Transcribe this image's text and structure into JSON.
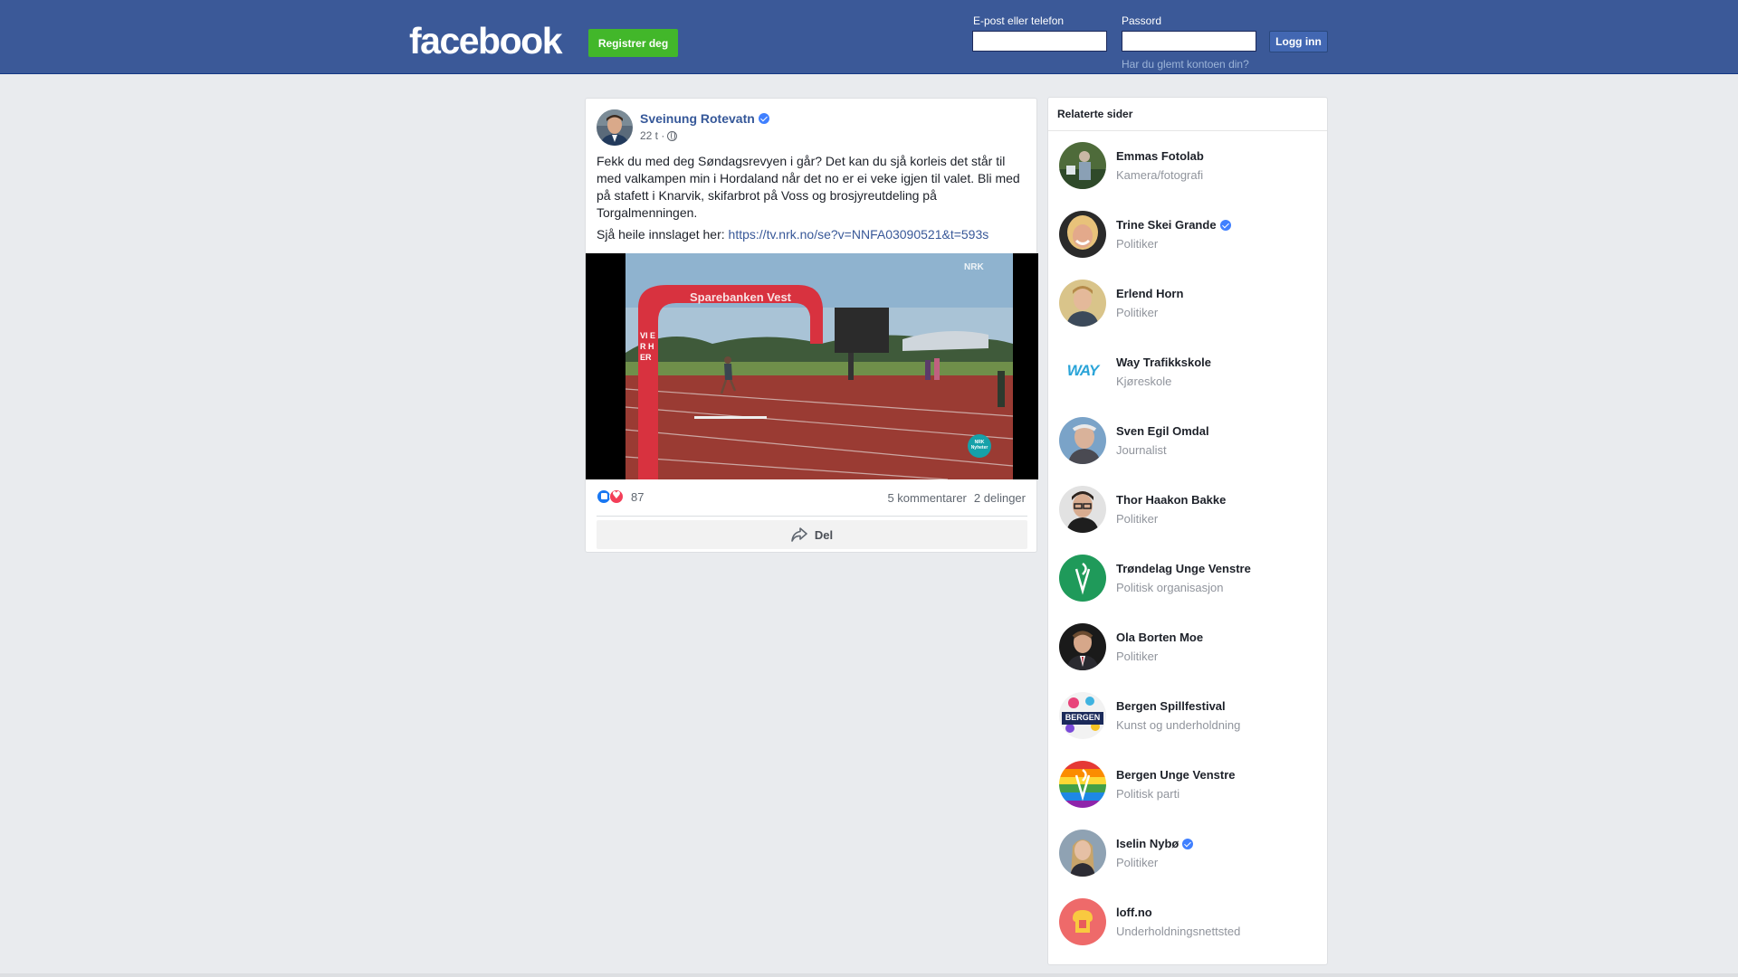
{
  "header": {
    "logo": "facebook",
    "register_label": "Registrer deg",
    "email_label": "E-post eller telefon",
    "password_label": "Passord",
    "login_label": "Logg inn",
    "forgot_label": "Har du glemt kontoen din?",
    "brand_color": "#3b5998"
  },
  "post": {
    "author": "Sveinung Rotevatn",
    "time": "22 t ·",
    "text": "Fekk du med deg Søndagsrevyen i går? Det kan du sjå korleis det står til med valkampen min i Hordaland når det no er ei veke igjen til valet. Bli med på stafett i Knarvik, skifarbrot på Voss og brosjyreutdeling på Torgalmenningen.",
    "link_prefix": "Sjå heile innslaget her:",
    "link_text": "https://tv.nrk.no/se?v=NNFA03090521&t=593s",
    "video_banner": "Sparebanken Vest",
    "video_arch_text": "VI ER HER",
    "video_logo": "NRK",
    "video_badge": "NRK Nyheter",
    "reaction_count": "87",
    "comments": "5 kommentarer",
    "shares": "2 delinger",
    "share_label": "Del"
  },
  "related": {
    "title": "Relaterte sider",
    "items": [
      {
        "name": "Emmas Fotolab",
        "category": "Kamera/fotografi",
        "verified": false
      },
      {
        "name": "Trine Skei Grande",
        "category": "Politiker",
        "verified": true
      },
      {
        "name": "Erlend Horn",
        "category": "Politiker",
        "verified": false
      },
      {
        "name": "Way Trafikkskole",
        "category": "Kjøreskole",
        "verified": false
      },
      {
        "name": "Sven Egil Omdal",
        "category": "Journalist",
        "verified": false
      },
      {
        "name": "Thor Haakon Bakke",
        "category": "Politiker",
        "verified": false
      },
      {
        "name": "Trøndelag Unge Venstre",
        "category": "Politisk organisasjon",
        "verified": false
      },
      {
        "name": "Ola Borten Moe",
        "category": "Politiker",
        "verified": false
      },
      {
        "name": "Bergen Spillfestival",
        "category": "Kunst og underholdning",
        "verified": false
      },
      {
        "name": "Bergen Unge Venstre",
        "category": "Politisk parti",
        "verified": false
      },
      {
        "name": "Iselin Nybø",
        "category": "Politiker",
        "verified": true
      },
      {
        "name": "loff.no",
        "category": "Underholdningsnettsted",
        "verified": false
      }
    ],
    "avatar_logo_text": {
      "way": "WAY",
      "bergen": "BERGEN"
    }
  }
}
